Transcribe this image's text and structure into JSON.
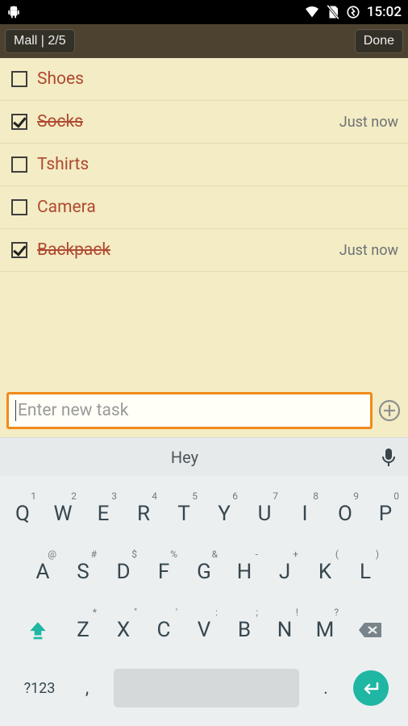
{
  "statusbar": {
    "time": "15:02"
  },
  "header": {
    "title_btn": "Mall | 2/5",
    "done": "Done"
  },
  "tasks": [
    {
      "label": "Shoes",
      "checked": false,
      "time": ""
    },
    {
      "label": "Socks",
      "checked": true,
      "time": "Just now"
    },
    {
      "label": "Tshirts",
      "checked": false,
      "time": ""
    },
    {
      "label": "Camera",
      "checked": false,
      "time": ""
    },
    {
      "label": "Backpack",
      "checked": true,
      "time": "Just now"
    }
  ],
  "entry": {
    "placeholder": "Enter new task"
  },
  "suggestion": {
    "text": "Hey"
  },
  "keyboard": {
    "row1": [
      {
        "m": "Q",
        "s": "1"
      },
      {
        "m": "W",
        "s": "2"
      },
      {
        "m": "E",
        "s": "3"
      },
      {
        "m": "R",
        "s": "4"
      },
      {
        "m": "T",
        "s": "5"
      },
      {
        "m": "Y",
        "s": "6"
      },
      {
        "m": "U",
        "s": "7"
      },
      {
        "m": "I",
        "s": "8"
      },
      {
        "m": "O",
        "s": "9"
      },
      {
        "m": "P",
        "s": "0"
      }
    ],
    "row2": [
      {
        "m": "A",
        "s": "@"
      },
      {
        "m": "S",
        "s": "#"
      },
      {
        "m": "D",
        "s": "$"
      },
      {
        "m": "F",
        "s": "%"
      },
      {
        "m": "G",
        "s": "&"
      },
      {
        "m": "H",
        "s": "-"
      },
      {
        "m": "J",
        "s": "+"
      },
      {
        "m": "K",
        "s": "("
      },
      {
        "m": "L",
        "s": ")"
      }
    ],
    "row3": [
      {
        "m": "Z",
        "s": "*"
      },
      {
        "m": "X",
        "s": "\""
      },
      {
        "m": "C",
        "s": "'"
      },
      {
        "m": "V",
        "s": ":"
      },
      {
        "m": "B",
        "s": ";"
      },
      {
        "m": "N",
        "s": "!"
      },
      {
        "m": "M",
        "s": "?"
      }
    ],
    "sym": "?123",
    "comma": ",",
    "dot": "."
  }
}
